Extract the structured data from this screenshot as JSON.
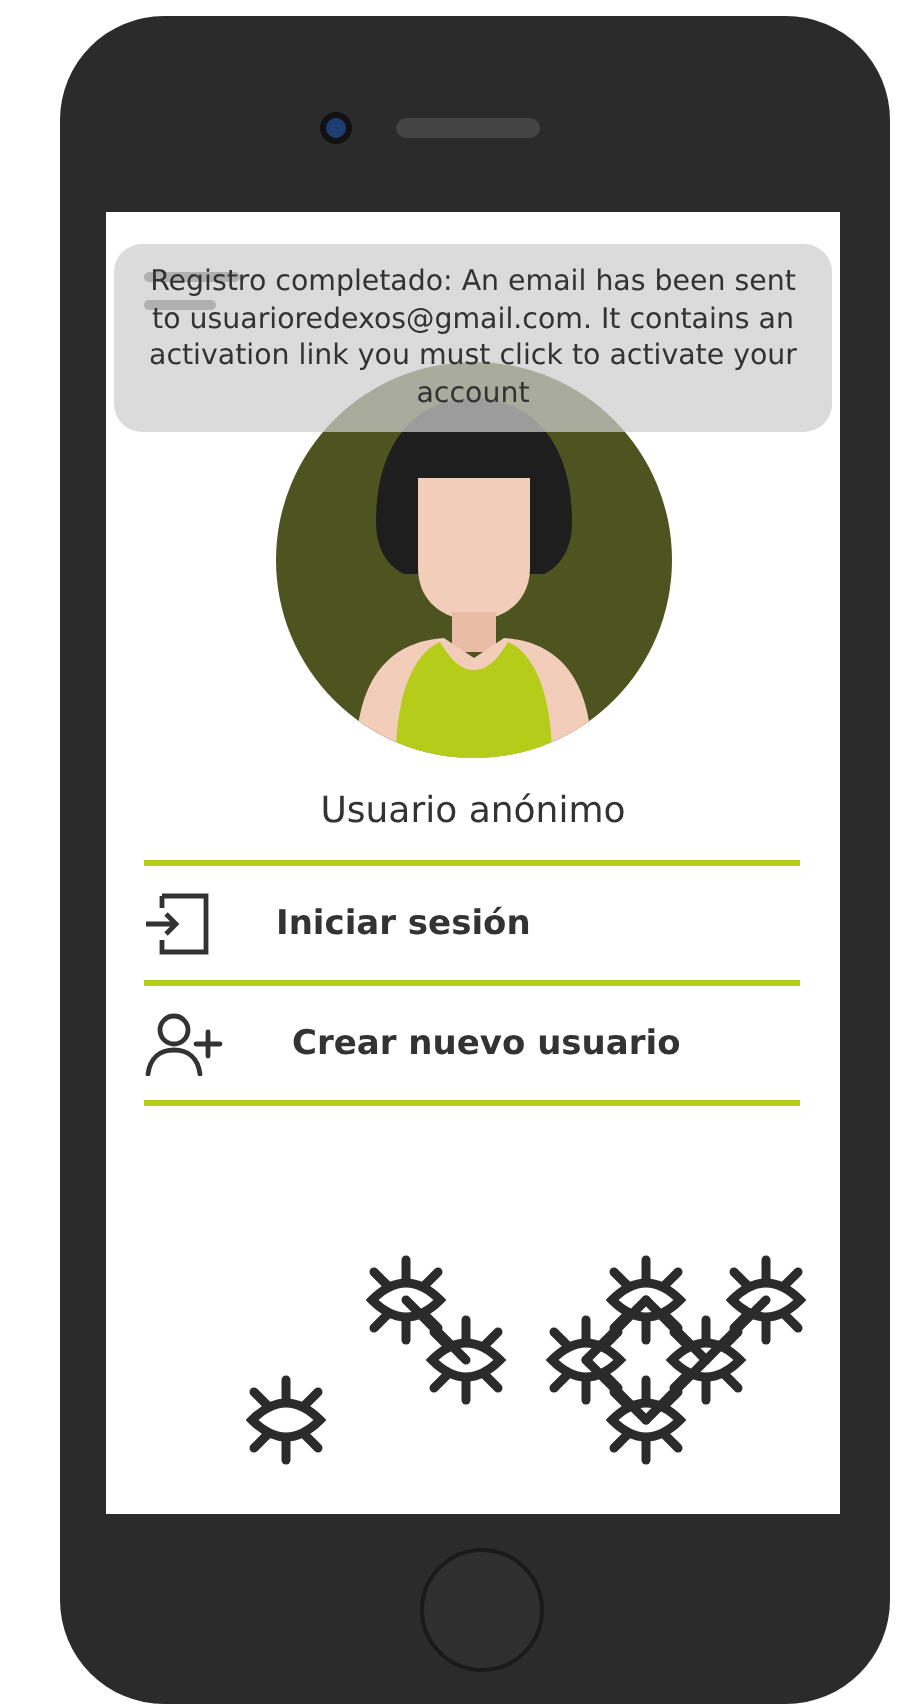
{
  "toast": {
    "message": "Registro completado: An email has been sent to usuarioredexos@gmail.com. It contains an activation link you must click to activate your account"
  },
  "profile": {
    "name": "Usuario anónimo"
  },
  "menu": [
    {
      "kind": "login",
      "label": "Iniciar sesión"
    },
    {
      "kind": "signup",
      "label": "Crear nuevo usuario"
    }
  ]
}
